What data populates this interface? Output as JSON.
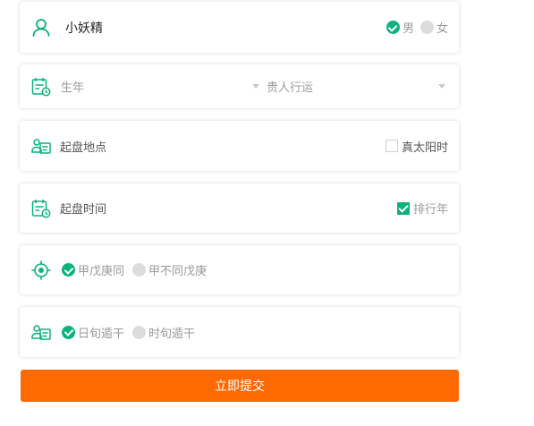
{
  "name_row": {
    "name": "小妖精",
    "gender_options": [
      {
        "label": "男",
        "selected": true
      },
      {
        "label": "女",
        "selected": false
      }
    ]
  },
  "year_row": {
    "year_placeholder": "生年",
    "noble_placeholder": "贵人行运"
  },
  "location_row": {
    "label": "起盘地点",
    "true_solar_label": "真太阳时",
    "true_solar_checked": false
  },
  "time_row": {
    "label": "起盘时间",
    "arrange_label": "排行年",
    "arrange_checked": true
  },
  "jia_row": {
    "options": [
      {
        "label": "甲戊庚同",
        "selected": true
      },
      {
        "label": "甲不同戊庚",
        "selected": false
      }
    ]
  },
  "xun_row": {
    "options": [
      {
        "label": "日旬遁干",
        "selected": true
      },
      {
        "label": "时旬遁干",
        "selected": false
      }
    ]
  },
  "submit_label": "立即提交",
  "colors": {
    "accent_green": "#0ab27c",
    "submit_orange": "#ff6a00",
    "radio_off": "#dcdcdc"
  }
}
